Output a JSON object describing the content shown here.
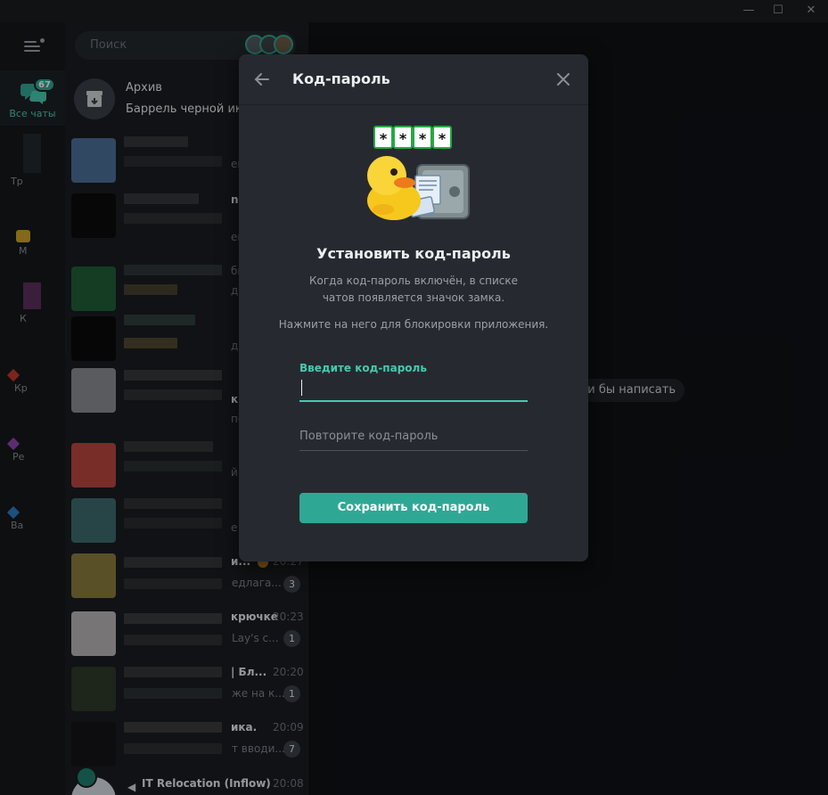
{
  "window": {
    "minimize_glyph": "—",
    "maximize_glyph": "☐",
    "close_glyph": "✕"
  },
  "sidebar": {
    "active_folder": {
      "label": "Все чаты",
      "badge": "67"
    },
    "folders_partial": [
      "Тр",
      "М",
      "К",
      "Кр",
      "Ре",
      "Ва"
    ]
  },
  "search": {
    "placeholder": "Поиск"
  },
  "archive": {
    "title": "Архив",
    "subtitle": "Баррель черной икр"
  },
  "chats": [
    {
      "name": "и...",
      "time": "20:27",
      "preview": "едлага...",
      "unread": "3"
    },
    {
      "name": "крючке",
      "time": "20:23",
      "preview": "Lay's c...",
      "unread": "1"
    },
    {
      "name": "| Бл...",
      "time": "20:20",
      "preview": "же на к...",
      "unread": "1"
    },
    {
      "name": "ика.",
      "time": "20:09",
      "preview": "т вводи...",
      "unread": "7"
    },
    {
      "name": "IT Relocation (Inflow)",
      "time": "20:08"
    }
  ],
  "chat_edge_fragments": [
    "ен",
    "nu",
    "ем",
    "би",
    "д",
    "д",
    "ки",
    "по",
    "й",
    "е"
  ],
  "main": {
    "empty_hint": "и бы написать"
  },
  "modal": {
    "title": "Код-пароль",
    "sticker_code": [
      "*",
      "*",
      "*",
      "*"
    ],
    "heading": "Установить код-пароль",
    "description": "Когда код-пароль включён, в списке чатов появляется значок замка.",
    "description2": "Нажмите на него для блокировки приложения.",
    "field1_label": "Введите код-пароль",
    "field2_placeholder": "Повторите код-пароль",
    "save_label": "Сохранить код-пароль"
  },
  "colors": {
    "accent": "#2ea894",
    "accent_text": "#47c9b0",
    "modal_bg": "#262a30",
    "sidebar_bg": "#14171b"
  }
}
